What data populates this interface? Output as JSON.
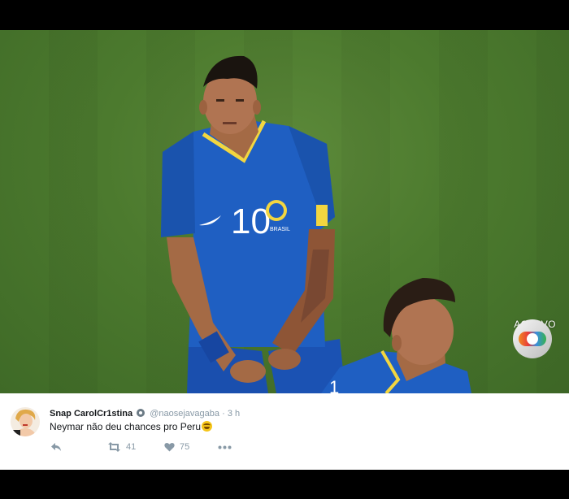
{
  "photo": {
    "alt": "",
    "jersey_number": "10",
    "badge_text": "BRASIL",
    "live_label": "AO VIVO",
    "live_logo": "globo-logo-icon"
  },
  "tweet": {
    "display_name": "Snap CarolCr1stina",
    "handle": "@naosejavagaba",
    "separator": "·",
    "time": "3 h",
    "text": "Neymar não deu chances pro Peru",
    "emoji": "laughing-crying-emoji",
    "actions": {
      "reply_icon": "reply-icon",
      "retweet_icon": "retweet-icon",
      "retweet_count": "41",
      "like_icon": "heart-icon",
      "like_count": "75",
      "more_icon": "more-dots-icon"
    }
  },
  "colors": {
    "pitch": "#4c7a2e",
    "jersey": "#1f5fc2",
    "accent_yellow": "#f2d640",
    "text_primary": "#14171a",
    "text_secondary": "#8899a6",
    "background": "#000000"
  }
}
